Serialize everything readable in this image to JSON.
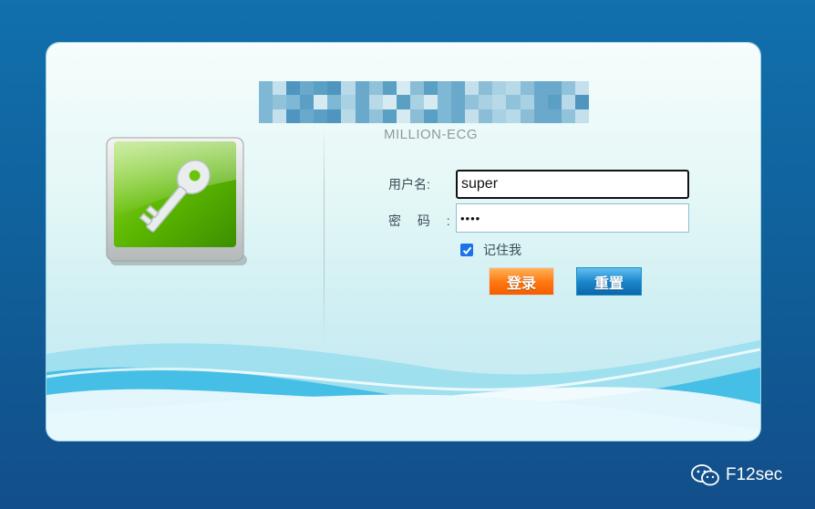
{
  "app": {
    "subtitle": "MILLION-ECG"
  },
  "form": {
    "username_label": "用户名:",
    "username_value": "super",
    "password_label": "密 码 :",
    "password_value": "••••",
    "remember_label": "记住我",
    "remember_checked": true
  },
  "buttons": {
    "login_label": "登录",
    "reset_label": "重置"
  },
  "watermark": {
    "text": "F12sec",
    "icon": "wechat-icon"
  },
  "colors": {
    "page_bg": "#1170ad",
    "login_button": "#ff7a12",
    "reset_button": "#1c87cc",
    "key_icon_green": "#5cb800"
  }
}
